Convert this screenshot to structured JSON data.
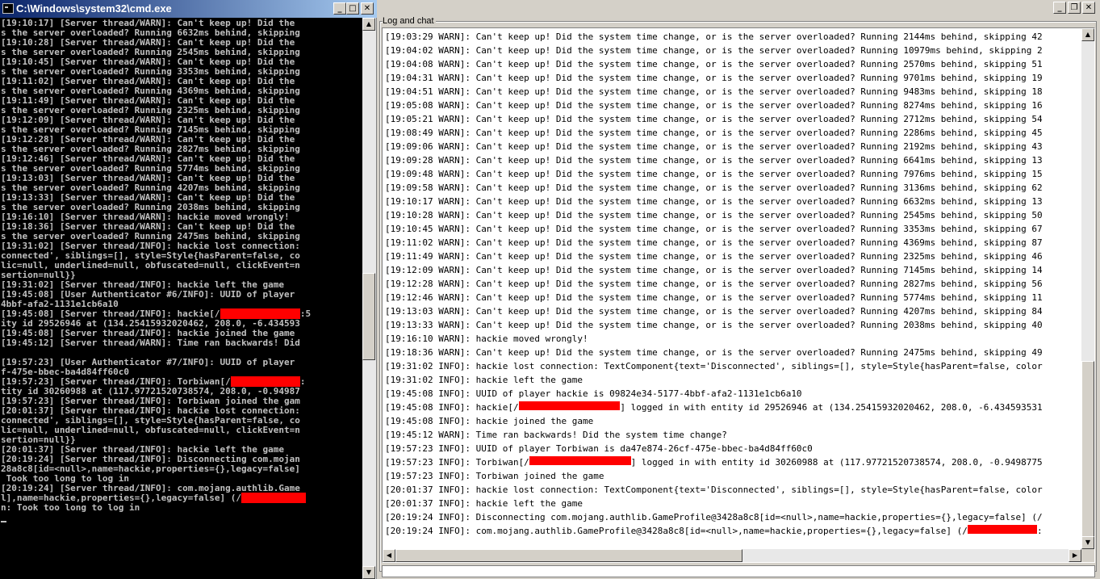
{
  "cmd": {
    "title": "C:\\Windows\\system32\\cmd.exe",
    "controls": {
      "minimize": "_",
      "maximize": "□",
      "close": "✕"
    },
    "lines": [
      "[19:10:17] [Server thread/WARN]: Can't keep up! Did the",
      "s the server overloaded? Running 6632ms behind, skipping",
      "[19:10:28] [Server thread/WARN]: Can't keep up! Did the",
      "s the server overloaded? Running 2545ms behind, skipping",
      "[19:10:45] [Server thread/WARN]: Can't keep up! Did the",
      "s the server overloaded? Running 3353ms behind, skipping",
      "[19:11:02] [Server thread/WARN]: Can't keep up! Did the",
      "s the server overloaded? Running 4369ms behind, skipping",
      "[19:11:49] [Server thread/WARN]: Can't keep up! Did the",
      "s the server overloaded? Running 2325ms behind, skipping",
      "[19:12:09] [Server thread/WARN]: Can't keep up! Did the",
      "s the server overloaded? Running 7145ms behind, skipping",
      "[19:12:28] [Server thread/WARN]: Can't keep up! Did the",
      "s the server overloaded? Running 2827ms behind, skipping",
      "[19:12:46] [Server thread/WARN]: Can't keep up! Did the",
      "s the server overloaded? Running 5774ms behind, skipping",
      "[19:13:03] [Server thread/WARN]: Can't keep up! Did the",
      "s the server overloaded? Running 4207ms behind, skipping",
      "[19:13:33] [Server thread/WARN]: Can't keep up! Did the",
      "s the server overloaded? Running 2038ms behind, skipping",
      "[19:16:10] [Server thread/WARN]: hackie moved wrongly!",
      "[19:18:36] [Server thread/WARN]: Can't keep up! Did the",
      "s the server overloaded? Running 2475ms behind, skipping",
      "[19:31:02] [Server thread/INFO]: hackie lost connection:",
      "connected', siblings=[], style=Style{hasParent=false, co",
      "lic=null, underlined=null, obfuscated=null, clickEvent=n",
      "sertion=null}}",
      "[19:31:02] [Server thread/INFO]: hackie left the game",
      "[19:45:08] [User Authenticator #6/INFO]: UUID of player",
      "4bbf-afa2-1131e1cb6a10",
      "[19:45:08] [Server thread/INFO]: hackie[/{{R:15}}:5",
      "ity id 29526946 at (134.25415932020462, 208.0, -6.434593",
      "[19:45:08] [Server thread/INFO]: hackie joined the game",
      "[19:45:12] [Server thread/WARN]: Time ran backwards! Did",
      "",
      "[19:57:23] [User Authenticator #7/INFO]: UUID of player",
      "f-475e-bbec-ba4d84ff60c0",
      "[19:57:23] [Server thread/INFO]: Torbiwan[/{{R:13}}:",
      "tity id 30260988 at (117.97721520738574, 208.0, -0.94987",
      "[19:57:23] [Server thread/INFO]: Torbiwan joined the gam",
      "[20:01:37] [Server thread/INFO]: hackie lost connection:",
      "connected', siblings=[], style=Style{hasParent=false, co",
      "lic=null, underlined=null, obfuscated=null, clickEvent=n",
      "sertion=null}}",
      "[20:01:37] [Server thread/INFO]: hackie left the game",
      "[20:19:24] [Server thread/INFO]: Disconnecting com.mojan",
      "28a8c8[id=<null>,name=hackie,properties={},legacy=false]",
      " Took too long to log in",
      "[20:19:24] [Server thread/INFO]: com.mojang.authlib.Game",
      "l],name=hackie,properties={},legacy=false] (/{{R:12}}",
      "n: Took too long to log in"
    ]
  },
  "gui": {
    "controls": {
      "minimize": "_",
      "maximize": "❐",
      "close": "✕"
    },
    "group_label": "Log and chat",
    "lines": [
      "[19:03:29 WARN]: Can't keep up! Did the system time change, or is the server overloaded? Running 2144ms behind, skipping 42",
      "[19:04:02 WARN]: Can't keep up! Did the system time change, or is the server overloaded? Running 10979ms behind, skipping 2",
      "[19:04:08 WARN]: Can't keep up! Did the system time change, or is the server overloaded? Running 2570ms behind, skipping 51",
      "[19:04:31 WARN]: Can't keep up! Did the system time change, or is the server overloaded? Running 9701ms behind, skipping 19",
      "[19:04:51 WARN]: Can't keep up! Did the system time change, or is the server overloaded? Running 9483ms behind, skipping 18",
      "[19:05:08 WARN]: Can't keep up! Did the system time change, or is the server overloaded? Running 8274ms behind, skipping 16",
      "[19:05:21 WARN]: Can't keep up! Did the system time change, or is the server overloaded? Running 2712ms behind, skipping 54",
      "[19:08:49 WARN]: Can't keep up! Did the system time change, or is the server overloaded? Running 2286ms behind, skipping 45",
      "[19:09:06 WARN]: Can't keep up! Did the system time change, or is the server overloaded? Running 2192ms behind, skipping 43",
      "[19:09:28 WARN]: Can't keep up! Did the system time change, or is the server overloaded? Running 6641ms behind, skipping 13",
      "[19:09:48 WARN]: Can't keep up! Did the system time change, or is the server overloaded? Running 7976ms behind, skipping 15",
      "[19:09:58 WARN]: Can't keep up! Did the system time change, or is the server overloaded? Running 3136ms behind, skipping 62",
      "[19:10:17 WARN]: Can't keep up! Did the system time change, or is the server overloaded? Running 6632ms behind, skipping 13",
      "[19:10:28 WARN]: Can't keep up! Did the system time change, or is the server overloaded? Running 2545ms behind, skipping 50",
      "[19:10:45 WARN]: Can't keep up! Did the system time change, or is the server overloaded? Running 3353ms behind, skipping 67",
      "[19:11:02 WARN]: Can't keep up! Did the system time change, or is the server overloaded? Running 4369ms behind, skipping 87",
      "[19:11:49 WARN]: Can't keep up! Did the system time change, or is the server overloaded? Running 2325ms behind, skipping 46",
      "[19:12:09 WARN]: Can't keep up! Did the system time change, or is the server overloaded? Running 7145ms behind, skipping 14",
      "[19:12:28 WARN]: Can't keep up! Did the system time change, or is the server overloaded? Running 2827ms behind, skipping 56",
      "[19:12:46 WARN]: Can't keep up! Did the system time change, or is the server overloaded? Running 5774ms behind, skipping 11",
      "[19:13:03 WARN]: Can't keep up! Did the system time change, or is the server overloaded? Running 4207ms behind, skipping 84",
      "[19:13:33 WARN]: Can't keep up! Did the system time change, or is the server overloaded? Running 2038ms behind, skipping 40",
      "[19:16:10 WARN]: hackie moved wrongly!",
      "[19:18:36 WARN]: Can't keep up! Did the system time change, or is the server overloaded? Running 2475ms behind, skipping 49",
      "[19:31:02 INFO]: hackie lost connection: TextComponent{text='Disconnected', siblings=[], style=Style{hasParent=false, color",
      "[19:31:02 INFO]: hackie left the game",
      "[19:45:08 INFO]: UUID of player hackie is 09824e34-5177-4bbf-afa2-1131e1cb6a10",
      "[19:45:08 INFO]: hackie[/{{R:19}}] logged in with entity id 29526946 at (134.25415932020462, 208.0, -6.434593531",
      "[19:45:08 INFO]: hackie joined the game",
      "[19:45:12 WARN]: Time ran backwards! Did the system time change?",
      "[19:57:23 INFO]: UUID of player Torbiwan is da47e874-26cf-475e-bbec-ba4d84ff60c0",
      "[19:57:23 INFO]: Torbiwan[/{{R:19}}] logged in with entity id 30260988 at (117.97721520738574, 208.0, -0.9498775",
      "[19:57:23 INFO]: Torbiwan joined the game",
      "[20:01:37 INFO]: hackie lost connection: TextComponent{text='Disconnected', siblings=[], style=Style{hasParent=false, color",
      "[20:01:37 INFO]: hackie left the game",
      "[20:19:24 INFO]: Disconnecting com.mojang.authlib.GameProfile@3428a8c8[id=<null>,name=hackie,properties={},legacy=false] (/",
      "[20:19:24 INFO]: com.mojang.authlib.GameProfile@3428a8c8[id=<null>,name=hackie,properties={},legacy=false] (/{{R:13}}:"
    ]
  },
  "colors": {
    "redaction": "#ff0000",
    "console_bg": "#000000",
    "console_fg": "#c0c0c0",
    "titlebar_start": "#0a246a",
    "titlebar_end": "#a6caf0"
  },
  "icons": {
    "cmd_window": "cmd-window-icon",
    "scroll_up": "scroll-up-arrow-icon",
    "scroll_down": "scroll-down-arrow-icon",
    "scroll_left": "scroll-left-arrow-icon",
    "scroll_right": "scroll-right-arrow-icon"
  }
}
